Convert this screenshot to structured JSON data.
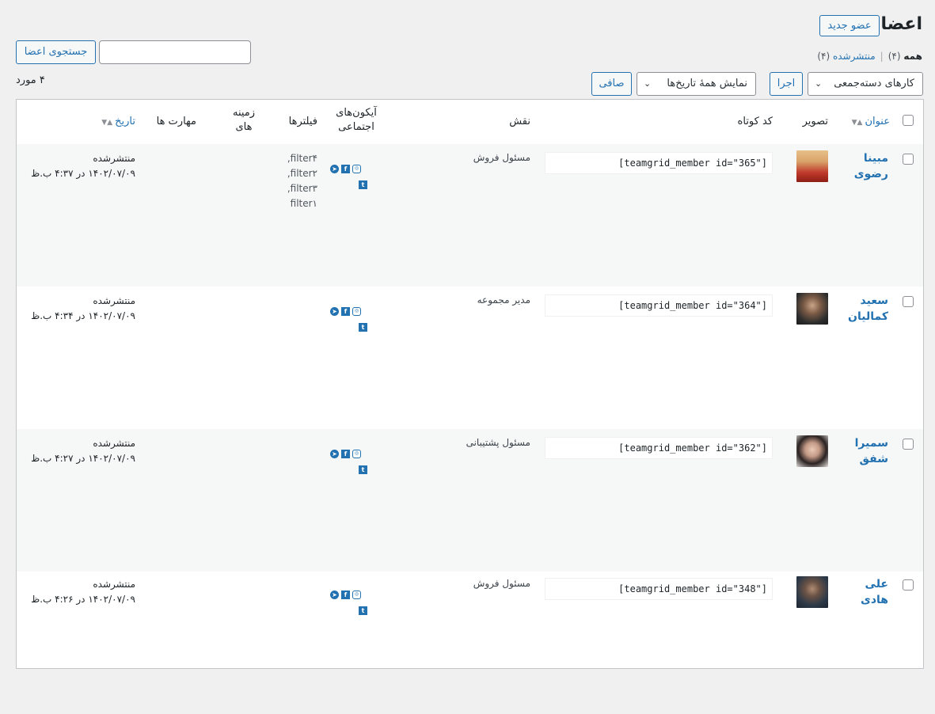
{
  "page": {
    "title": "اعضا",
    "add_new_label": "عضو جدید"
  },
  "views": {
    "all_label": "همه",
    "all_count": "(۴)",
    "published_label": "منتشرشده",
    "published_count": "(۴)",
    "separator": "|"
  },
  "search": {
    "value": "",
    "button_label": "جستجوی اعضا"
  },
  "toolbar": {
    "bulk_actions_selected": "کارهای دسته‌جمعی",
    "apply_label": "اجرا",
    "date_filter_selected": "نمایش همهٔ تاریخ‌ها",
    "filter_label": "صافی",
    "items_count": "۴ مورد"
  },
  "columns": {
    "title": "عنوان",
    "image": "تصویر",
    "shortcode": "کد کوتاه",
    "role": "نقش",
    "social_line1": "آیکون‌های",
    "social_line2": "اجتماعی",
    "filters": "فیلترها",
    "bg_line1": "زمینه",
    "bg_line2": "های",
    "skills": "مهارت ها",
    "date": "تاریخ"
  },
  "rows": [
    {
      "name_line1": "مبینا",
      "name_line2": "رضوی",
      "shortcode": "[teamgrid_member id=\"365\"]",
      "role": "مسئول فروش",
      "filters": [
        "filter۴,",
        "filter۲,",
        "filter۳,",
        "filter۱"
      ],
      "status": "منتشرشده",
      "date": "۱۴۰۲/۰۷/۰۹ در ۴:۳۷ ب.ظ",
      "thumb_color": "#c0392b"
    },
    {
      "name_line1": "سعید",
      "name_line2": "کمالیان",
      "shortcode": "[teamgrid_member id=\"364\"]",
      "role": "مدیر مجموعه",
      "filters": [],
      "status": "منتشرشده",
      "date": "۱۴۰۲/۰۷/۰۹ در ۴:۳۴ ب.ظ",
      "thumb_color": "#3b3b3b"
    },
    {
      "name_line1": "سمیرا",
      "name_line2": "شفق",
      "shortcode": "[teamgrid_member id=\"362\"]",
      "role": "مسئول پشتیبانی",
      "filters": [],
      "status": "منتشرشده",
      "date": "۱۴۰۲/۰۷/۰۹ در ۴:۲۷ ب.ظ",
      "thumb_color": "#d8d4d0"
    },
    {
      "name_line1": "علی",
      "name_line2": "هادی",
      "shortcode": "[teamgrid_member id=\"348\"]",
      "role": "مسئول فروش",
      "filters": [],
      "status": "منتشرشده",
      "date": "۱۴۰۲/۰۷/۰۹ در ۴:۲۶ ب.ظ",
      "thumb_color": "#2e3a48"
    }
  ],
  "social_icons": [
    "instagram-icon",
    "facebook-icon",
    "telegram-icon",
    "twitter-icon"
  ],
  "colors": {
    "link": "#2271b1",
    "border": "#c3c4c7",
    "bg": "#f0f0f1"
  }
}
